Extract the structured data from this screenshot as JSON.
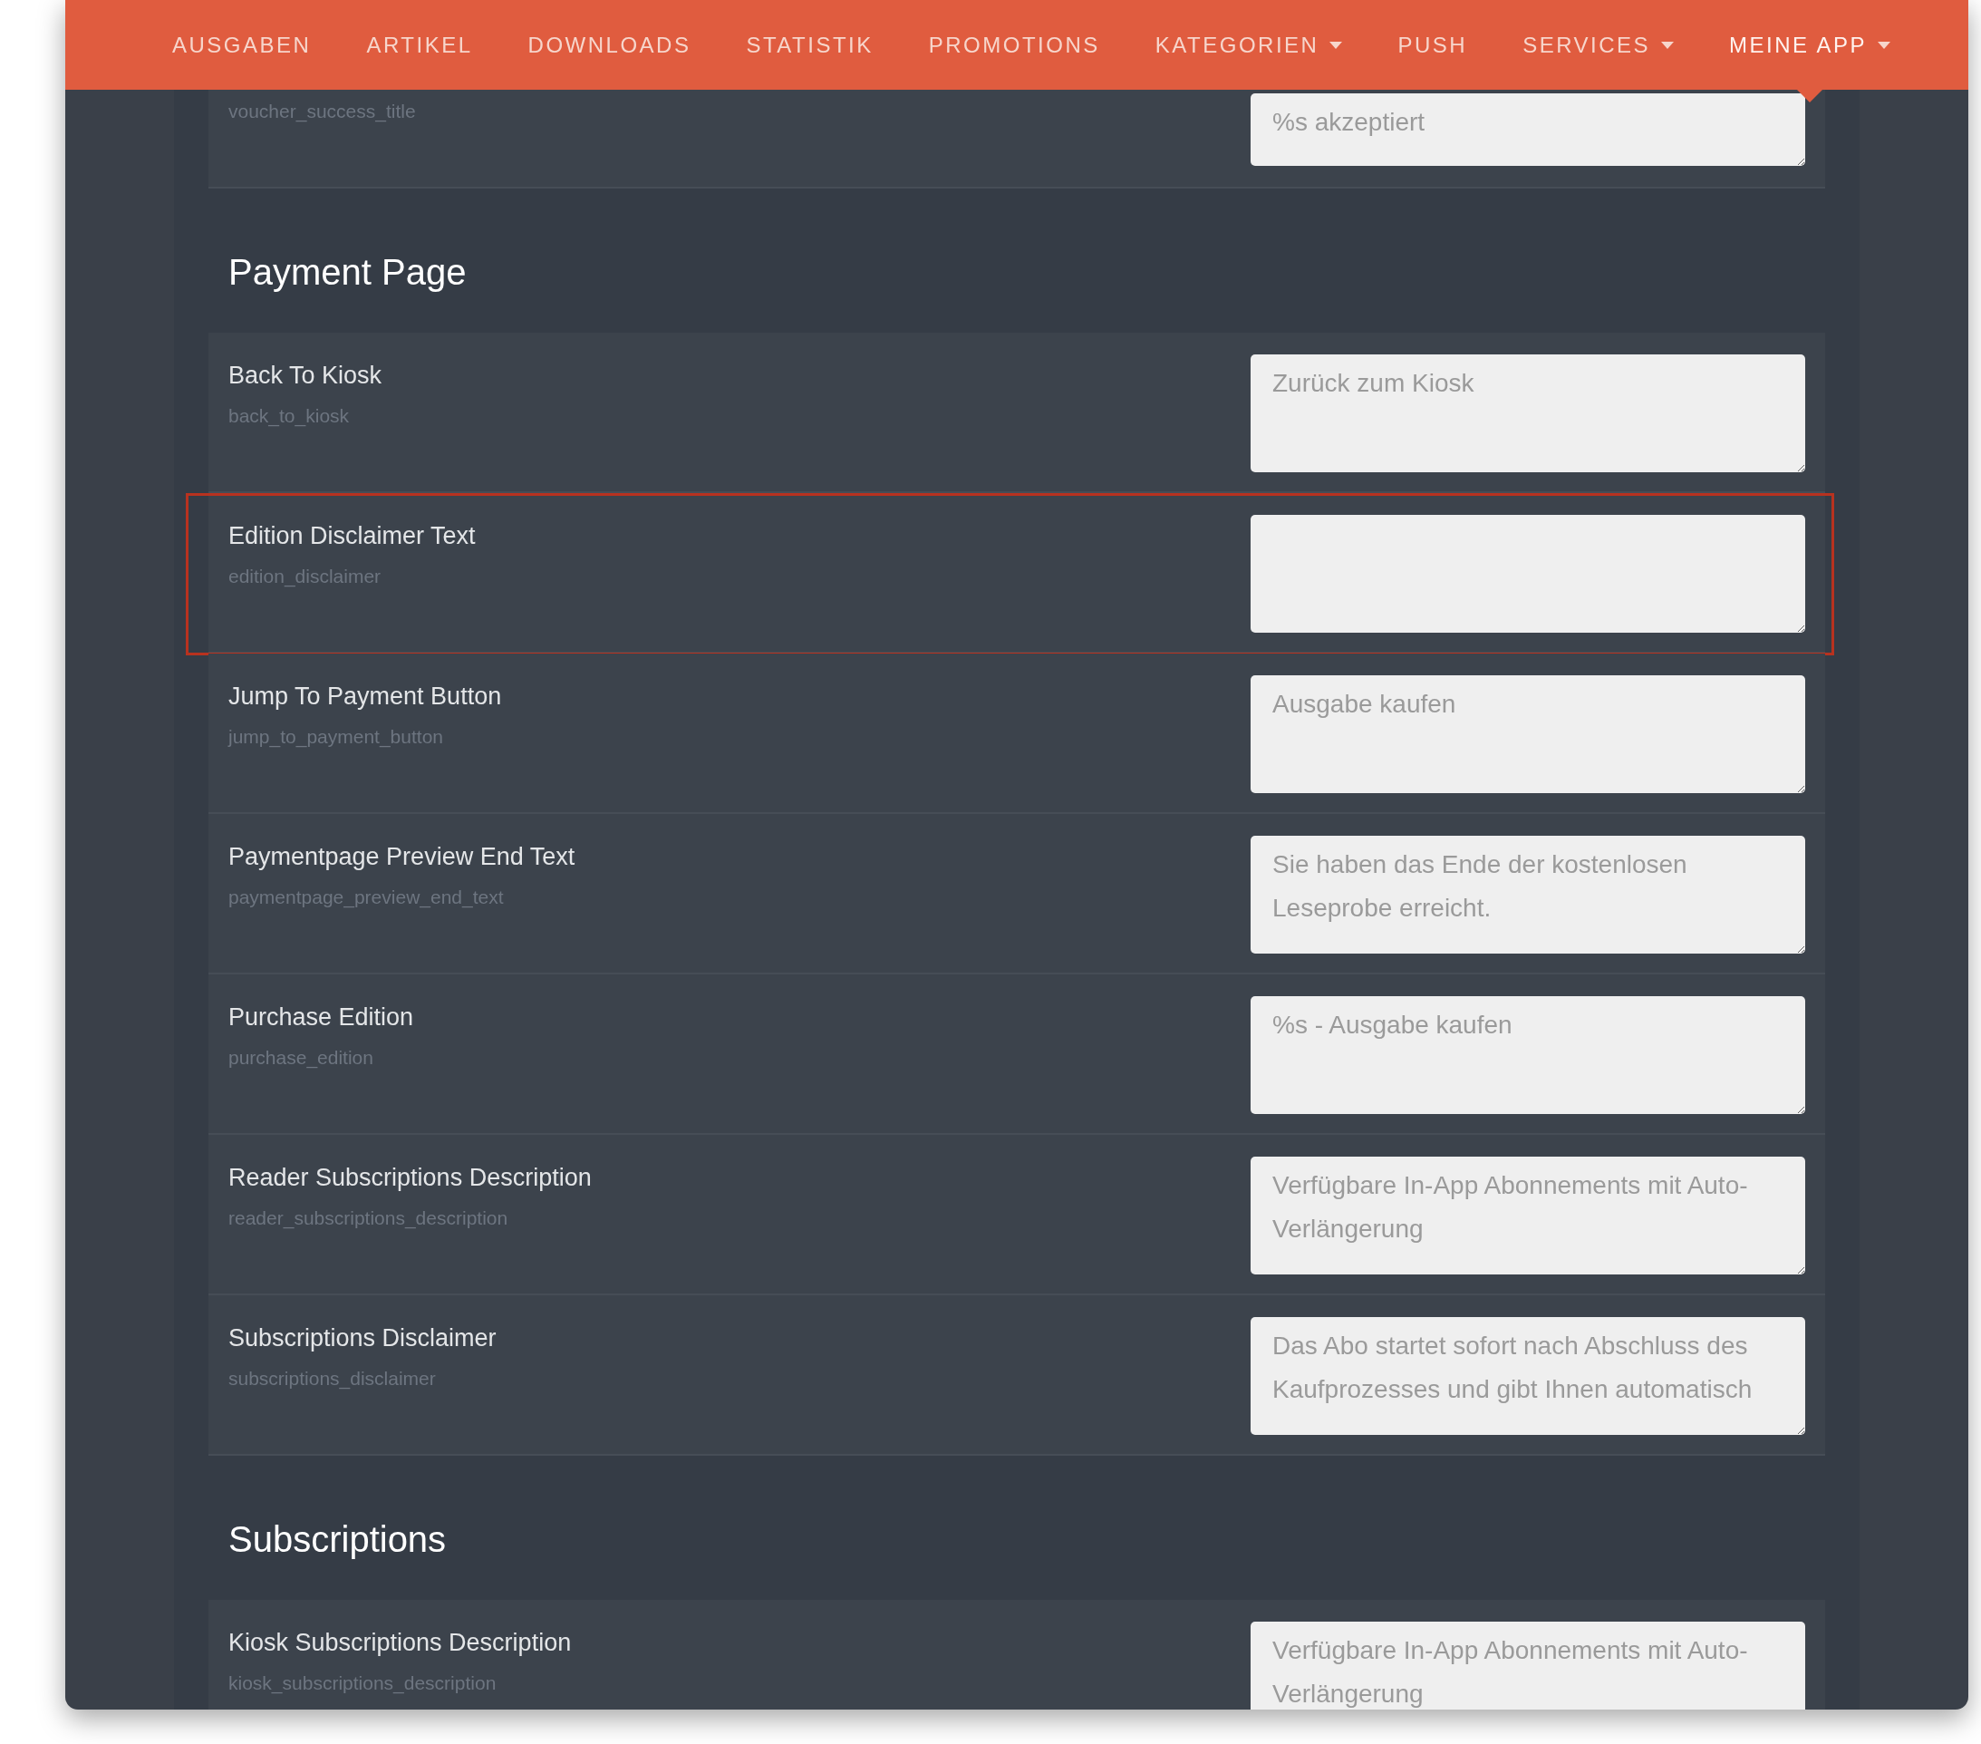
{
  "nav": {
    "items": [
      {
        "label": "AUSGABEN",
        "dropdown": false,
        "selected": false
      },
      {
        "label": "ARTIKEL",
        "dropdown": false,
        "selected": false
      },
      {
        "label": "DOWNLOADS",
        "dropdown": false,
        "selected": false
      },
      {
        "label": "STATISTIK",
        "dropdown": false,
        "selected": false
      },
      {
        "label": "PROMOTIONS",
        "dropdown": false,
        "selected": false
      },
      {
        "label": "KATEGORIEN",
        "dropdown": true,
        "selected": false
      },
      {
        "label": "PUSH",
        "dropdown": false,
        "selected": false
      },
      {
        "label": "SERVICES",
        "dropdown": true,
        "selected": false
      },
      {
        "label": "MEINE APP",
        "dropdown": true,
        "selected": true
      }
    ]
  },
  "sections": [
    {
      "rows": [
        {
          "key": "voucher_success_title",
          "placeholder": "%s akzeptiert",
          "highlighted": false
        }
      ]
    },
    {
      "title": "Payment Page",
      "rows": [
        {
          "label": "Back To Kiosk",
          "key": "back_to_kiosk",
          "placeholder": "Zurück zum Kiosk",
          "highlighted": false
        },
        {
          "label": "Edition Disclaimer Text",
          "key": "edition_disclaimer",
          "highlighted": true
        },
        {
          "label": "Jump To Payment Button",
          "key": "jump_to_payment_button",
          "placeholder": "Ausgabe kaufen",
          "highlighted": false
        },
        {
          "label": "Paymentpage Preview End Text",
          "key": "paymentpage_preview_end_text",
          "placeholder": "Sie haben das Ende der kostenlosen Leseprobe erreicht.",
          "highlighted": false
        },
        {
          "label": "Purchase Edition",
          "key": "purchase_edition",
          "placeholder": "%s - Ausgabe kaufen",
          "highlighted": false
        },
        {
          "label": "Reader Subscriptions Description",
          "key": "reader_subscriptions_description",
          "placeholder": "Verfügbare In-App Abonnements mit Auto-Verlängerung",
          "highlighted": false
        },
        {
          "label": "Subscriptions Disclaimer",
          "key": "subscriptions_disclaimer",
          "placeholder": "Das Abo startet sofort nach Abschluss des Kaufprozesses und gibt Ihnen automatisch",
          "highlighted": false
        }
      ]
    },
    {
      "title": "Subscriptions",
      "rows": [
        {
          "label": "Kiosk Subscriptions Description",
          "key": "kiosk_subscriptions_description",
          "placeholder": "Verfügbare In-App Abonnements mit Auto-Verlängerung",
          "highlighted": false
        }
      ]
    }
  ]
}
